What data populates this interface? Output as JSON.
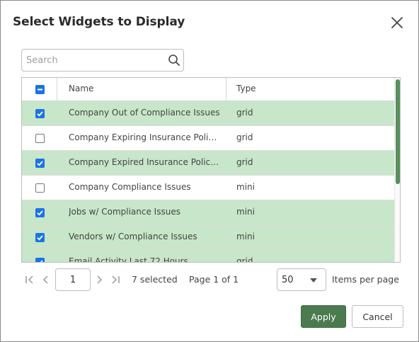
{
  "dialog": {
    "title": "Select Widgets to Display"
  },
  "search": {
    "placeholder": "Search"
  },
  "grid": {
    "columns": [
      "Name",
      "Type"
    ],
    "header_checkbox_state": "indeterminate",
    "rows": [
      {
        "name": "Company Out of Compliance Issues",
        "type": "grid",
        "selected": true
      },
      {
        "name": "Company Expiring Insurance Policies",
        "type": "grid",
        "selected": false
      },
      {
        "name": "Company Expired Insurance Policies",
        "type": "grid",
        "selected": true
      },
      {
        "name": "Company Compliance Issues",
        "type": "mini",
        "selected": false
      },
      {
        "name": "Jobs w/ Compliance Issues",
        "type": "mini",
        "selected": true
      },
      {
        "name": "Vendors w/ Compliance Issues",
        "type": "mini",
        "selected": true
      },
      {
        "name": "Email Activity Last 72 Hours",
        "type": "grid",
        "selected": true
      }
    ]
  },
  "pager": {
    "current_page": "1",
    "selected_text": "7 selected",
    "page_info": "Page 1 of 1",
    "page_size": "50",
    "items_per_page_label": "Items per page"
  },
  "actions": {
    "apply_label": "Apply",
    "cancel_label": "Cancel"
  },
  "colors": {
    "selected_row": "#c8e6c9",
    "checkbox_accent": "#1a73e8",
    "apply_button": "#4b7a4f",
    "scroll_thumb": "#5a8f5e"
  }
}
